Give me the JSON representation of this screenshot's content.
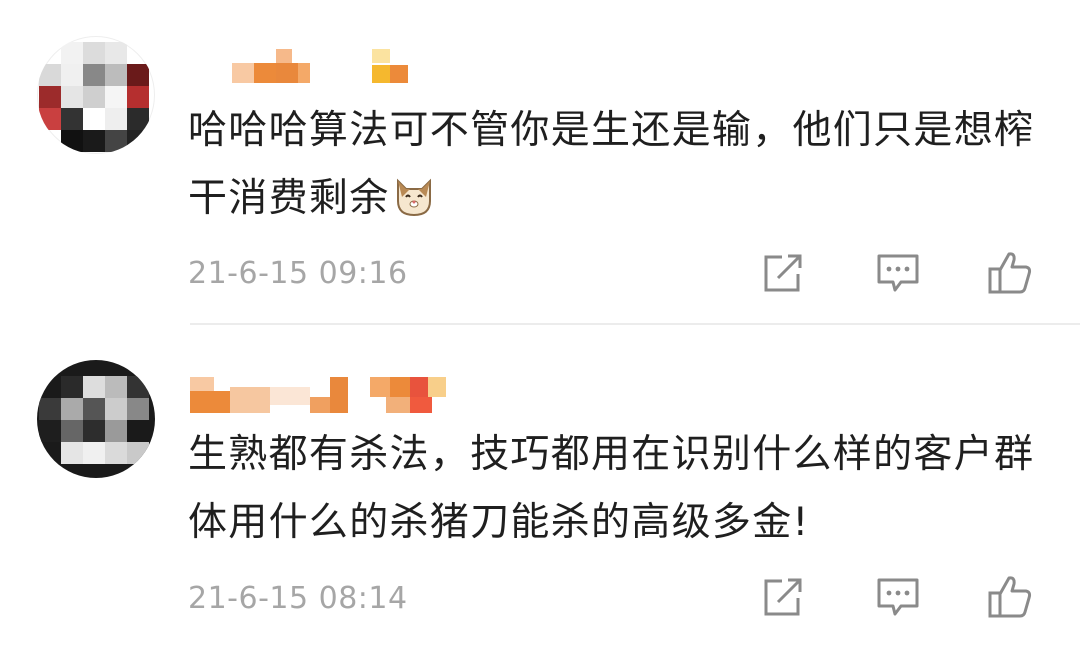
{
  "comments": [
    {
      "avatar_icon": "pixelated-avatar",
      "username_icon": "pixelated-username",
      "text": "哈哈哈算法可不管你是生还是输，他们只是想榨干消费剩余",
      "emoji_icon": "cat-face-emoji",
      "timestamp": "21-6-15 09:16",
      "actions": {
        "share_icon": "share-icon",
        "reply_icon": "comment-icon",
        "like_icon": "thumbs-up-icon"
      }
    },
    {
      "avatar_icon": "pixelated-avatar",
      "username_icon": "pixelated-username",
      "text": "生熟都有杀法，技巧都用在识别什么样的客户群体用什么的杀猪刀能杀的高级多金!",
      "timestamp": "21-6-15 08:14",
      "actions": {
        "share_icon": "share-icon",
        "reply_icon": "comment-icon",
        "like_icon": "thumbs-up-icon"
      }
    }
  ],
  "colors": {
    "username_orange": "#ec8a3a",
    "username_light": "#f8c9a3",
    "username_yellow": "#f5b82e",
    "username_red": "#e8533d",
    "timestamp": "#a6a6a6",
    "icon_gray": "#8a8a8a",
    "divider": "#ececec"
  }
}
